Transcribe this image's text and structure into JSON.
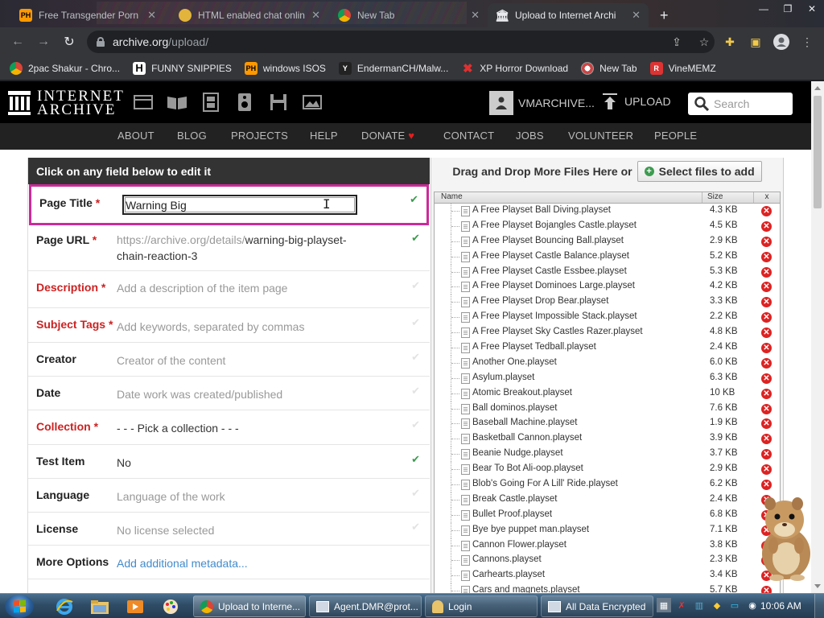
{
  "browser": {
    "tabs": [
      {
        "title": "Free Transgender Porn",
        "favicon": "PH"
      },
      {
        "title": "HTML enabled chat onlin",
        "favicon": "globe"
      },
      {
        "title": "New Tab",
        "favicon": "chrome"
      },
      {
        "title": "Upload to Internet Archi",
        "favicon": "ia"
      }
    ],
    "url_domain": "archive.org",
    "url_path": "/upload/",
    "bookmarks": [
      {
        "label": "2pac Shakur - Chro...",
        "icon": "chrome-icon"
      },
      {
        "label": "FUNNY SNIPPIES",
        "icon": "H"
      },
      {
        "label": "windows ISOS",
        "icon": "PH"
      },
      {
        "label": "EndermanCH/Malw...",
        "icon": "Y"
      },
      {
        "label": "XP Horror Download",
        "icon": "X"
      },
      {
        "label": "New Tab",
        "icon": "chrome-icon"
      },
      {
        "label": "VineMEMZ",
        "icon": "R"
      }
    ]
  },
  "ia": {
    "logo_line1": "INTERNET",
    "logo_line2": "ARCHIVE",
    "username": "VMARCHIVE...",
    "upload_label": "UPLOAD",
    "search_placeholder": "Search",
    "nav": [
      "ABOUT",
      "BLOG",
      "PROJECTS",
      "HELP",
      "DONATE",
      "CONTACT",
      "JOBS",
      "VOLUNTEER",
      "PEOPLE"
    ]
  },
  "form": {
    "header": "Click on any field below to edit it",
    "fields": {
      "title": {
        "label": "Page Title",
        "value": "Warning Big"
      },
      "url": {
        "label": "Page URL",
        "prefix": "https://archive.org/details/",
        "slug1": "warning-big-playset-",
        "slug2": "chain-reaction-3"
      },
      "description": {
        "label": "Description",
        "placeholder": "Add a description of the item page"
      },
      "subject": {
        "label": "Subject Tags",
        "placeholder": "Add keywords, separated by commas"
      },
      "creator": {
        "label": "Creator",
        "placeholder": "Creator of the content"
      },
      "date": {
        "label": "Date",
        "placeholder": "Date work was created/published"
      },
      "collection": {
        "label": "Collection",
        "value": "- - - Pick a collection - - -"
      },
      "test_item": {
        "label": "Test Item",
        "value": "No"
      },
      "language": {
        "label": "Language",
        "placeholder": "Language of the work"
      },
      "license": {
        "label": "License",
        "placeholder": "No license selected"
      },
      "more": {
        "label": "More Options",
        "link": "Add additional metadata..."
      }
    },
    "required_marker": "*"
  },
  "files": {
    "drop_text": "Drag and Drop More Files Here or",
    "select_label": "Select files to add",
    "col_name": "Name",
    "col_size": "Size",
    "col_x": "x",
    "rows": [
      {
        "name": "A Free Playset Ball Diving.playset",
        "size": "4.3 KB"
      },
      {
        "name": "A Free Playset Bojangles Castle.playset",
        "size": "4.5 KB"
      },
      {
        "name": "A Free Playset Bouncing Ball.playset",
        "size": "2.9 KB"
      },
      {
        "name": "A Free Playset Castle Balance.playset",
        "size": "5.2 KB"
      },
      {
        "name": "A Free Playset Castle Essbee.playset",
        "size": "5.3 KB"
      },
      {
        "name": "A Free Playset Dominoes Large.playset",
        "size": "4.2 KB"
      },
      {
        "name": "A Free Playset Drop Bear.playset",
        "size": "3.3 KB"
      },
      {
        "name": "A Free Playset Impossible Stack.playset",
        "size": "2.2 KB"
      },
      {
        "name": "A Free Playset Sky Castles Razer.playset",
        "size": "4.8 KB"
      },
      {
        "name": "A Free Playset Tedball.playset",
        "size": "2.4 KB"
      },
      {
        "name": "Another One.playset",
        "size": "6.0 KB"
      },
      {
        "name": "Asylum.playset",
        "size": "6.3 KB"
      },
      {
        "name": "Atomic Breakout.playset",
        "size": "10 KB"
      },
      {
        "name": "Ball dominos.playset",
        "size": "7.6 KB"
      },
      {
        "name": "Baseball Machine.playset",
        "size": "1.9 KB"
      },
      {
        "name": "Basketball Cannon.playset",
        "size": "3.9 KB"
      },
      {
        "name": "Beanie Nudge.playset",
        "size": "3.7 KB"
      },
      {
        "name": "Bear To Bot Ali-oop.playset",
        "size": "2.9 KB"
      },
      {
        "name": "Blob's Going For A Lill' Ride.playset",
        "size": "6.2 KB"
      },
      {
        "name": "Break Castle.playset",
        "size": "2.4 KB"
      },
      {
        "name": "Bullet Proof.playset",
        "size": "6.8 KB"
      },
      {
        "name": "Bye bye puppet man.playset",
        "size": "7.1 KB"
      },
      {
        "name": "Cannon Flower.playset",
        "size": "3.8 KB"
      },
      {
        "name": "Cannons.playset",
        "size": "2.3 KB"
      },
      {
        "name": "Carhearts.playset",
        "size": "3.4 KB"
      },
      {
        "name": "Cars and magnets.playset",
        "size": "5.7 KB"
      }
    ]
  },
  "taskbar": {
    "buttons": [
      {
        "label": "Upload to Interne..."
      },
      {
        "label": "Agent.DMR@prot..."
      },
      {
        "label": "Login"
      },
      {
        "label": "All Data Encrypted"
      }
    ],
    "clock": "10:06 AM"
  },
  "colors": {
    "accent_pink": "#cc2b9a",
    "required_red": "#cc2222",
    "check_green": "#3c9b4f",
    "link_blue": "#428bca"
  }
}
